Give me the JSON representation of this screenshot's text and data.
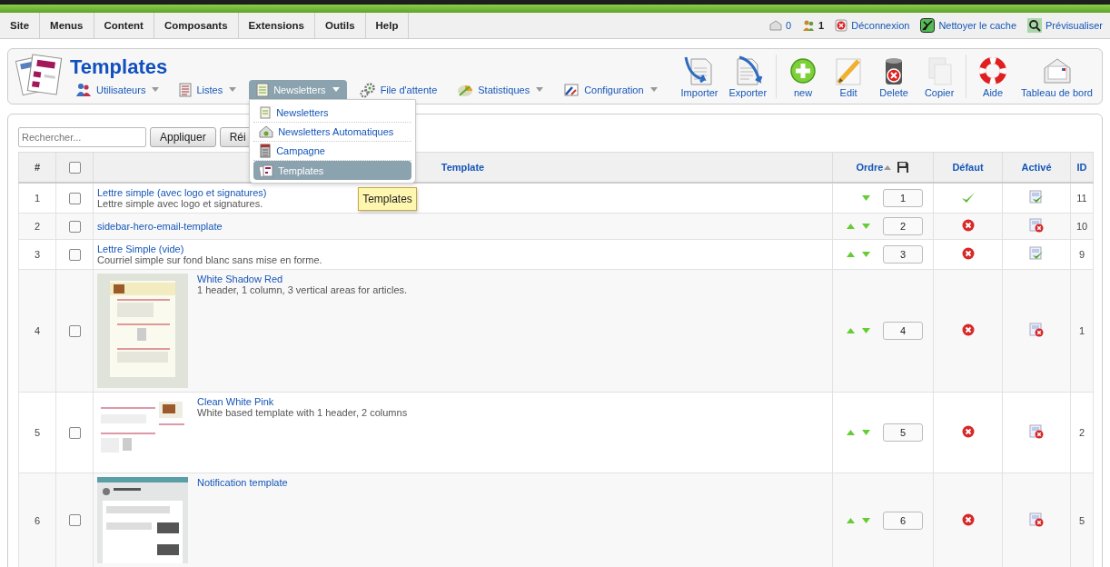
{
  "menubar": {
    "items": [
      {
        "label": "Site"
      },
      {
        "label": "Menus"
      },
      {
        "label": "Content"
      },
      {
        "label": "Composants"
      },
      {
        "label": "Extensions"
      },
      {
        "label": "Outils"
      },
      {
        "label": "Help"
      }
    ]
  },
  "status": {
    "items": [
      {
        "kind": "messages",
        "label": "0"
      },
      {
        "kind": "users",
        "label": "1"
      },
      {
        "kind": "logout",
        "label": "Déconnexion"
      },
      {
        "kind": "cache",
        "label": "Nettoyer le cache"
      },
      {
        "kind": "preview",
        "label": "Prévisualiser"
      }
    ]
  },
  "header": {
    "title": "Templates",
    "nav": [
      {
        "kind": "users",
        "label": "Utilisateurs",
        "caret": true,
        "selected": false
      },
      {
        "kind": "lists",
        "label": "Listes",
        "caret": true,
        "selected": false
      },
      {
        "kind": "newsletters",
        "label": "Newsletters",
        "caret": true,
        "selected": true
      },
      {
        "kind": "queue",
        "label": "File d'attente",
        "caret": false,
        "selected": false
      },
      {
        "kind": "stats",
        "label": "Statistiques",
        "caret": true,
        "selected": false
      },
      {
        "kind": "config",
        "label": "Configuration",
        "caret": true,
        "selected": false
      }
    ],
    "toolbar_groups": [
      [
        {
          "kind": "import",
          "label": "Importer"
        },
        {
          "kind": "export",
          "label": "Exporter"
        }
      ],
      [
        {
          "kind": "new",
          "label": "new"
        },
        {
          "kind": "edit",
          "label": "Edit"
        },
        {
          "kind": "delete",
          "label": "Delete"
        },
        {
          "kind": "copy",
          "label": "Copier"
        }
      ],
      [
        {
          "kind": "help",
          "label": "Aide"
        },
        {
          "kind": "dashboard",
          "label": "Tableau de bord"
        }
      ]
    ]
  },
  "dropdown": {
    "items": [
      {
        "kind": "newsletters",
        "label": "Newsletters",
        "selected": false
      },
      {
        "kind": "auto",
        "label": "Newsletters Automatiques",
        "selected": false
      },
      {
        "kind": "campaign",
        "label": "Campagne",
        "selected": false
      },
      {
        "kind": "templates",
        "label": "Templates",
        "selected": true
      }
    ],
    "tooltip": "Templates"
  },
  "filter": {
    "placeholder": "Rechercher...",
    "buttons": [
      "Appliquer",
      "Réi"
    ]
  },
  "table": {
    "select_all": false,
    "columns": [
      "#",
      "Template",
      "Ordre",
      "Défaut",
      "Activé",
      "ID"
    ],
    "rows": [
      {
        "num": "1",
        "checked": false,
        "title": "Lettre simple (avec logo et signatures)",
        "description": "Lettre simple avec logo et signatures.",
        "thumbnail": false,
        "can_up": false,
        "can_down": true,
        "order": "1",
        "default": true,
        "enabled": true,
        "id": "11"
      },
      {
        "num": "2",
        "checked": false,
        "title": "sidebar-hero-email-template",
        "thumbnail": false,
        "can_up": true,
        "can_down": true,
        "order": "2",
        "default": false,
        "enabled": false,
        "id": "10"
      },
      {
        "num": "3",
        "checked": false,
        "title": "Lettre Simple (vide)",
        "description": "Courriel simple sur fond blanc sans mise en forme.",
        "thumbnail": false,
        "can_up": true,
        "can_down": true,
        "order": "3",
        "default": false,
        "enabled": true,
        "id": "9"
      },
      {
        "num": "4",
        "checked": false,
        "title": "White Shadow Red",
        "description": "1 header, 1 column, 3 vertical areas for articles.",
        "thumbnail": true,
        "can_up": true,
        "can_down": true,
        "order": "4",
        "default": false,
        "enabled": false,
        "id": "1"
      },
      {
        "num": "5",
        "checked": false,
        "title": "Clean White Pink",
        "description": "White based template with 1 header, 2 columns",
        "thumbnail": true,
        "can_up": true,
        "can_down": true,
        "order": "5",
        "default": false,
        "enabled": false,
        "id": "2"
      },
      {
        "num": "6",
        "checked": false,
        "title": "Notification template",
        "thumbnail": true,
        "can_up": true,
        "can_down": true,
        "order": "6",
        "default": false,
        "enabled": false,
        "id": "5"
      }
    ]
  }
}
